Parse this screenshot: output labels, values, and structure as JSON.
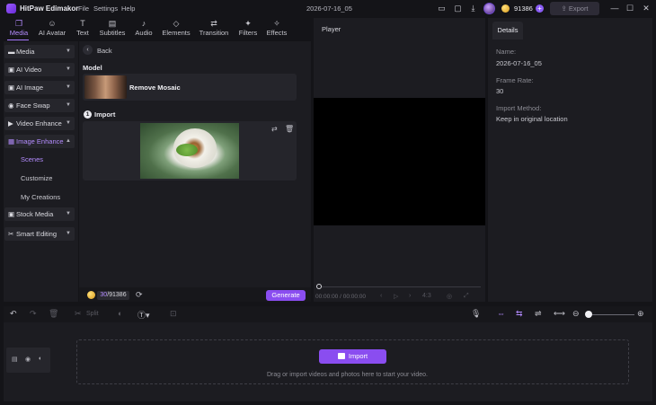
{
  "app": {
    "name": "HitPaw Edimakor",
    "menu": [
      "File",
      "Settings",
      "Help"
    ],
    "project_title": "2026-07-16_05",
    "credits": "91386",
    "export_label": "Export"
  },
  "top_tabs": [
    {
      "label": "Media",
      "icon": "media-icon",
      "active": true
    },
    {
      "label": "AI Avatar",
      "icon": "avatar-icon",
      "active": false
    },
    {
      "label": "Text",
      "icon": "text-icon",
      "active": false
    },
    {
      "label": "Subtitles",
      "icon": "subtitles-icon",
      "active": false
    },
    {
      "label": "Audio",
      "icon": "audio-icon",
      "active": false
    },
    {
      "label": "Elements",
      "icon": "elements-icon",
      "active": false
    },
    {
      "label": "Transition",
      "icon": "transition-icon",
      "active": false
    },
    {
      "label": "Filters",
      "icon": "filters-icon",
      "active": false
    },
    {
      "label": "Effects",
      "icon": "effects-icon",
      "active": false
    }
  ],
  "sidebar": {
    "items": [
      {
        "label": "Media",
        "icon": "folder-icon"
      },
      {
        "label": "AI Video",
        "icon": "ai-video-icon"
      },
      {
        "label": "AI Image",
        "icon": "ai-image-icon"
      },
      {
        "label": "Face Swap",
        "icon": "face-swap-icon"
      },
      {
        "label": "Video Enhance",
        "icon": "video-enhance-icon"
      },
      {
        "label": "Image Enhance",
        "icon": "image-enhance-icon",
        "active": true
      },
      {
        "label": "Stock Media",
        "icon": "stock-media-icon"
      },
      {
        "label": "Smart Editing",
        "icon": "smart-editing-icon"
      }
    ],
    "subitems": [
      "Scenes",
      "Customize",
      "My Creations"
    ],
    "active_subitem": "Scenes"
  },
  "center": {
    "back_label": "Back",
    "model_heading": "Model",
    "model_name": "Remove Mosaic",
    "import_step": "1",
    "import_heading": "Import",
    "credits_used": "30",
    "credits_total": "/91386",
    "generate_label": "Generate"
  },
  "player": {
    "title": "Player",
    "time": "00:00:00 / 00:00:00",
    "aspect": "4:3"
  },
  "details": {
    "tab": "Details",
    "fields": [
      {
        "label": "Name:",
        "value": "2026-07-16_05"
      },
      {
        "label": "Frame Rate:",
        "value": "30"
      },
      {
        "label": "Import Method:",
        "value": "Keep in original location"
      }
    ]
  },
  "timeline": {
    "split_label": "Split",
    "import_label": "Import",
    "drop_hint": "Drag or import videos and photos here to start your video.",
    "zoom_level": 0
  },
  "colors": {
    "accent": "#8a4df0",
    "accent_text": "#b48cff",
    "panel": "#1c1c21",
    "background": "#141418"
  }
}
